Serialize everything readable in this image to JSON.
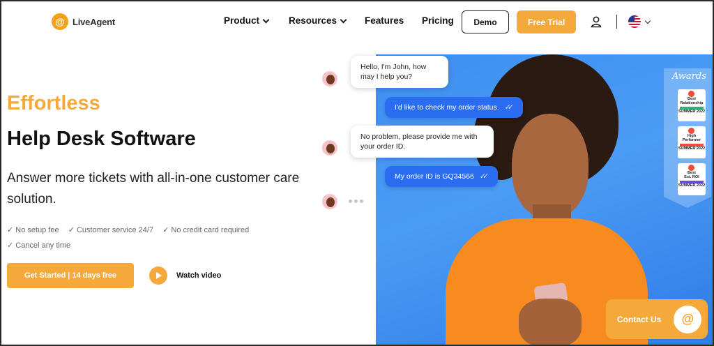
{
  "brand": {
    "name": "LiveAgent",
    "mark": "@",
    "accent": "#f6a93b"
  },
  "nav": {
    "items": [
      {
        "label": "Product",
        "has_dropdown": true
      },
      {
        "label": "Resources",
        "has_dropdown": true
      },
      {
        "label": "Features",
        "has_dropdown": false
      },
      {
        "label": "Pricing",
        "has_dropdown": false
      }
    ],
    "demo_label": "Demo",
    "trial_label": "Free Trial",
    "user_icon": "user-icon",
    "language_icon": "us-flag-icon"
  },
  "hero": {
    "title_highlight": "Effortless",
    "title_main": "Help Desk Software",
    "subtitle": "Answer more tickets with all-in-one customer care solution.",
    "checks": [
      "✓ No setup fee",
      "✓ Customer service 24/7",
      "✓ No credit card required",
      "✓ Cancel any time"
    ],
    "cta_label": "Get Started | 14 days free",
    "video_label": "Watch video"
  },
  "chat": [
    {
      "from": "agent",
      "text": "Hello, I'm John, how may I help you?"
    },
    {
      "from": "user",
      "text": "I'd like to check my order status."
    },
    {
      "from": "agent",
      "text": "No problem, please provide me with your order ID."
    },
    {
      "from": "user",
      "text": "My order ID is GQ34566"
    }
  ],
  "awards": {
    "title": "Awards",
    "badges": [
      {
        "line1": "Best",
        "line2": "Relationship",
        "line3": "SUMMER 2022"
      },
      {
        "line1": "High",
        "line2": "Performer",
        "line3": "SUMMER 2022"
      },
      {
        "line1": "Best",
        "line2": "Est. ROI",
        "line3": "SUMMER 2022"
      }
    ]
  },
  "contact": {
    "label": "Contact Us"
  }
}
